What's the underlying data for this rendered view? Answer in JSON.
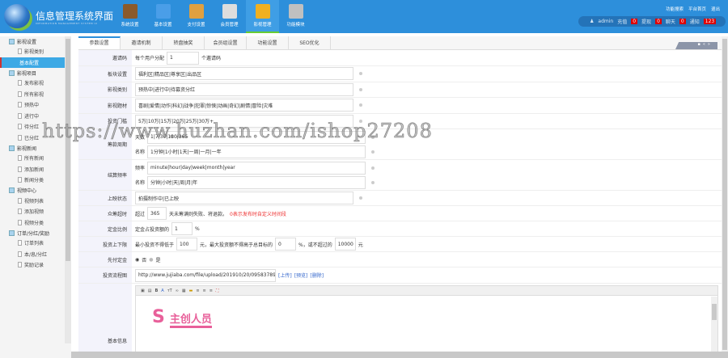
{
  "header": {
    "title": "信息管理系统界面",
    "subtitle": "INFORMATION MANAGEMENT SYSTEM UI",
    "nav": [
      {
        "label": "系统设置",
        "color": "#8b5a2b"
      },
      {
        "label": "基本设置",
        "color": "#4a9ee8"
      },
      {
        "label": "支付设置",
        "color": "#e0a040"
      },
      {
        "label": "会员管理",
        "color": "#dddddd"
      },
      {
        "label": "影视管理",
        "color": "#f0b020"
      },
      {
        "label": "功能模块",
        "color": "#c0c0c0"
      }
    ],
    "links": [
      "功能搜索",
      "平台首页",
      "退出"
    ],
    "user": "admin",
    "counters": [
      {
        "label": "充值",
        "value": "0"
      },
      {
        "label": "提现",
        "value": "0"
      },
      {
        "label": "聊天",
        "value": "0"
      },
      {
        "label": "通知",
        "value": "123"
      }
    ]
  },
  "sidebar": [
    {
      "group": "影视设置",
      "items": [
        "影视类别",
        "基本配置"
      ]
    },
    {
      "group": "影视项目",
      "items": [
        "发布影视",
        "所有影视",
        "预热中",
        "进行中",
        "待分红",
        "已分红"
      ]
    },
    {
      "group": "影视新闻",
      "items": [
        "所有新闻",
        "添加新闻",
        "新闻分类"
      ]
    },
    {
      "group": "视频中心",
      "items": [
        "视频列表",
        "添加视频",
        "视频分类"
      ]
    },
    {
      "group": "订单/分红/奖励",
      "items": [
        "订单列表",
        "本/息/分红",
        "奖励记录"
      ]
    }
  ],
  "tabs": [
    "参数设置",
    "邀请机制",
    "转盘抽奖",
    "会员组设置",
    "功能设置",
    "SEO优化"
  ],
  "form": {
    "invite": {
      "label": "邀请码",
      "pre": "每个用户分配",
      "value": "1",
      "post": "个邀请码"
    },
    "board": {
      "label": "板块设置",
      "value": "福利区|精品区|尊享区|出品区"
    },
    "category": {
      "label": "影视类别",
      "value": "预热中|进行中|待募资分红"
    },
    "theme": {
      "label": "影视题材",
      "value": "喜剧|爱情|动作|科幻|战争|犯罪|惊悚|动画|奇幻|剧情|冒险|灾难"
    },
    "threshold": {
      "label": "投资门槛",
      "value": "5万|10万|15万|20万|25万|30万+"
    },
    "cycle": {
      "label": "筹款周期",
      "days_label": "天数",
      "days": "1|7|30|180|365",
      "name_label": "名称",
      "names": "1分钟|1小时|1天|一周|一月|一年"
    },
    "freq": {
      "label": "结算频率",
      "code_label": "频率",
      "codes": "minute|hour|day|week|month|year",
      "name_label": "名称",
      "names": "分钟|小时|天|周|月|年"
    },
    "status": {
      "label": "上映状态",
      "value": "拍摄制作中|已上映"
    },
    "timeout": {
      "label": "众筹超时",
      "pre": "超过",
      "value": "365",
      "post": "天未筹满则失败、将退款。",
      "note": "0表示发布时自定义时间段"
    },
    "deposit": {
      "label": "定金比例",
      "pre": "定金占投资额的",
      "value": "1",
      "post": "%"
    },
    "limits": {
      "label": "投资上下限",
      "pre": "最小投资不得低于",
      "min": "100",
      "mid": "元，最大投资额不得高于总目标的",
      "pct": "0",
      "mid2": "%，或不超过的",
      "max": "10000",
      "post": "元"
    },
    "prepay": {
      "label": "先付定金",
      "options": [
        "否",
        "是"
      ]
    },
    "flow": {
      "label": "投资流程图",
      "value": "http://www.jujiaba.com/file/upload/201910/20/095837891",
      "actions": [
        "[上传]",
        "[预览]",
        "[删除]"
      ]
    },
    "basic": {
      "label": "基本信息",
      "heading": "主创人员"
    }
  },
  "watermark": "https://www.huzhan.com/ishop27208"
}
